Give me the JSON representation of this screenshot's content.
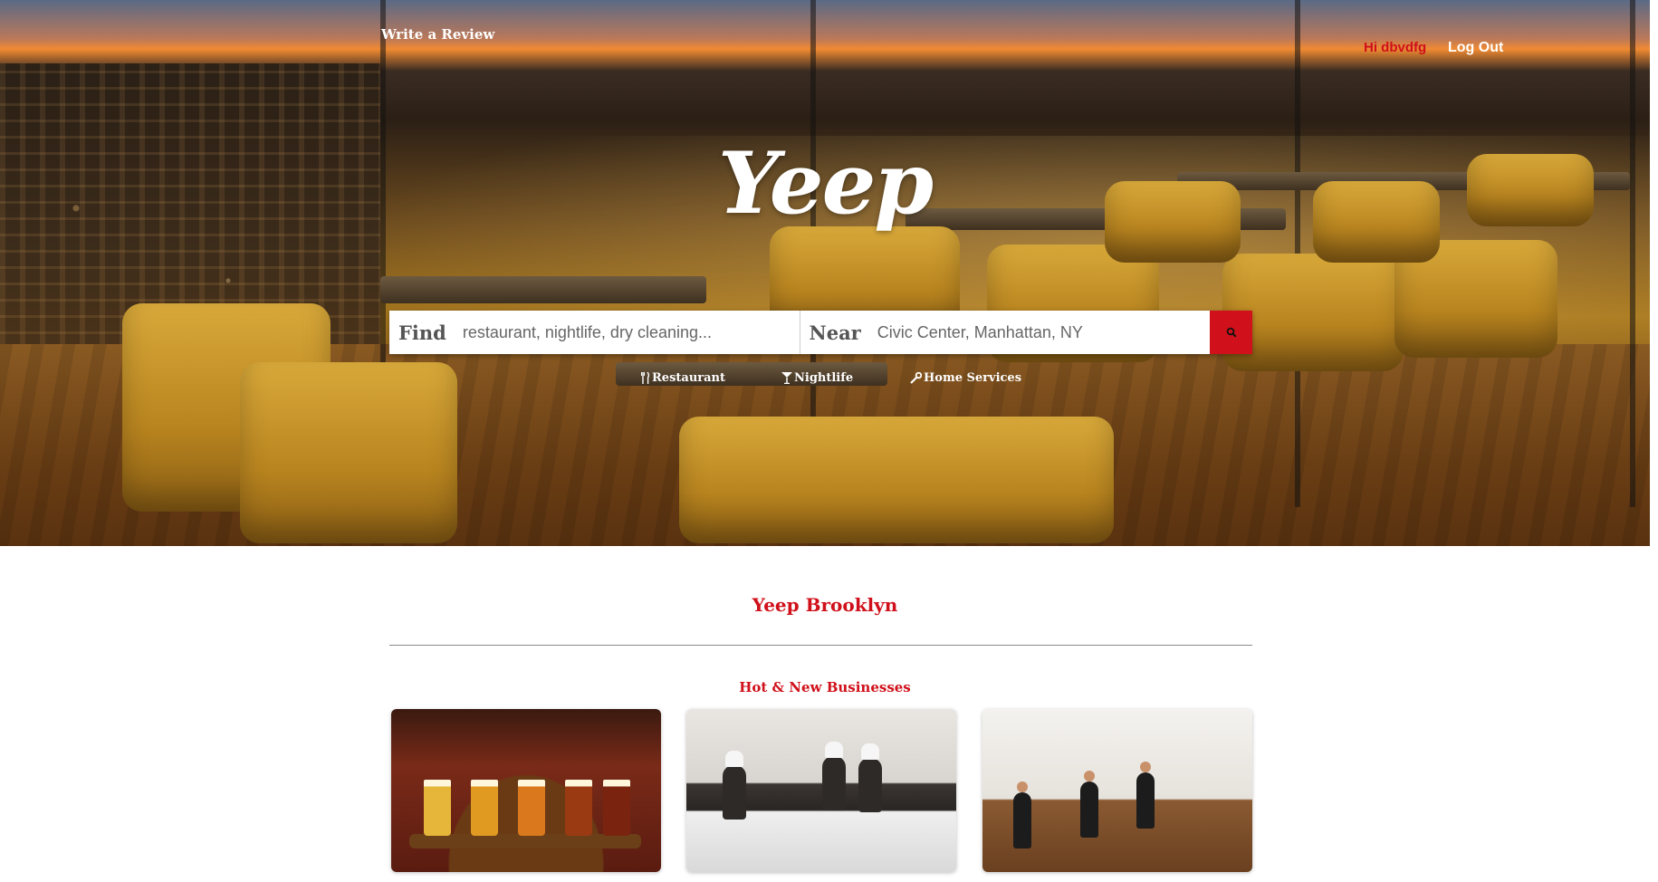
{
  "nav": {
    "write_review": "Write a Review",
    "greeting": "Hi dbvdfg",
    "logout": "Log Out"
  },
  "hero": {
    "logo": "Yeep"
  },
  "search": {
    "find_label": "Find",
    "find_placeholder": "restaurant, nightlife, dry cleaning...",
    "near_label": "Near",
    "near_placeholder": "Civic Center, Manhattan, NY",
    "submit_icon": "search-icon"
  },
  "categories": [
    {
      "label": "Restaurant",
      "icon": "fork-knife-icon"
    },
    {
      "label": "Nightlife",
      "icon": "cocktail-icon"
    },
    {
      "label": "Home Services",
      "icon": "wrench-icon"
    }
  ],
  "main": {
    "section_title": "Yeep Brooklyn",
    "subsection_title": "Hot & New Businesses"
  },
  "colors": {
    "accent": "#d0101a",
    "white": "#ffffff"
  }
}
